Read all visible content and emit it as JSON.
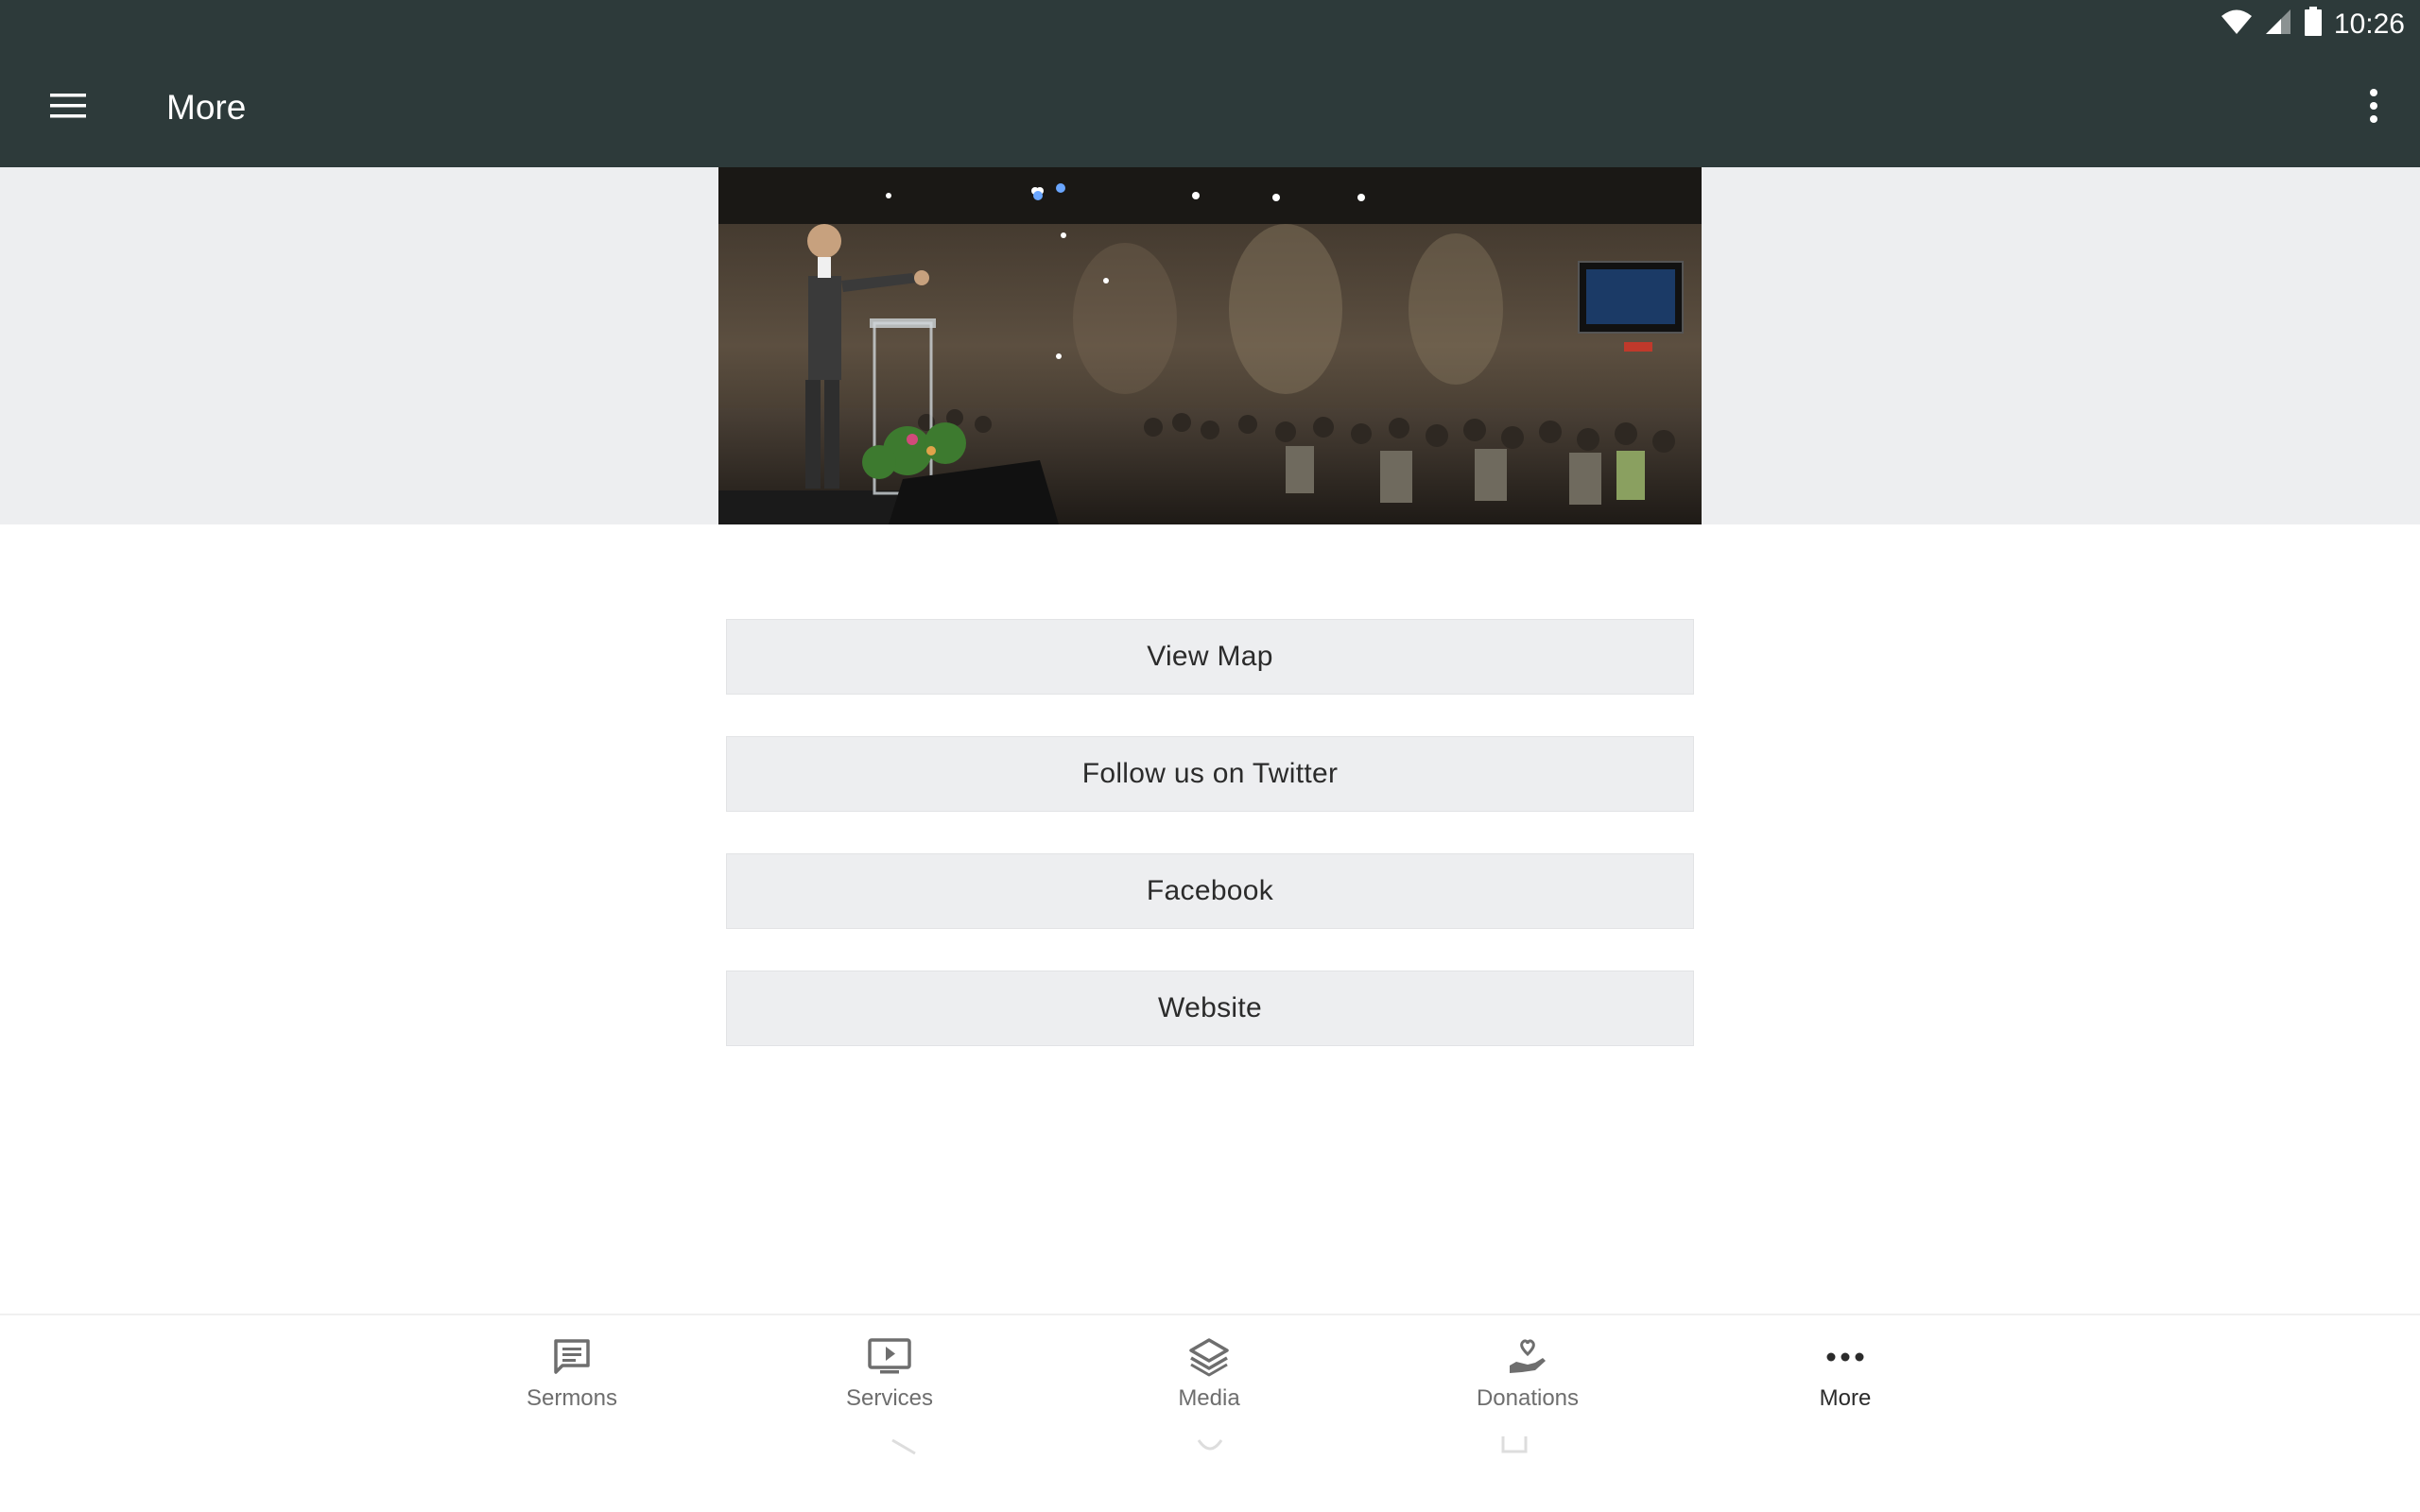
{
  "status_bar": {
    "time": "10:26",
    "icons": [
      "wifi-icon",
      "cell-signal-icon",
      "battery-icon"
    ]
  },
  "app_bar": {
    "title": "More",
    "menu_icon": "hamburger-menu-icon",
    "overflow_icon": "more-vert-icon"
  },
  "hero": {
    "image": "church-sermon-photo"
  },
  "actions": [
    {
      "label": "View Map"
    },
    {
      "label": "Follow us on Twitter"
    },
    {
      "label": "Facebook"
    },
    {
      "label": "Website"
    }
  ],
  "bottom_nav": {
    "items": [
      {
        "label": "Sermons",
        "icon": "chat-bubble-icon"
      },
      {
        "label": "Services",
        "icon": "tv-play-icon"
      },
      {
        "label": "Media",
        "icon": "layers-icon"
      },
      {
        "label": "Donations",
        "icon": "heart-hand-icon"
      },
      {
        "label": "More",
        "icon": "more-horiz-icon",
        "active": true
      }
    ]
  },
  "colors": {
    "app_bar": "#2d3a3a",
    "hero_bg": "#edeef0",
    "button_bg": "#edeef0",
    "nav_inactive": "#6e6e6e",
    "nav_active": "#2b2b2b"
  }
}
